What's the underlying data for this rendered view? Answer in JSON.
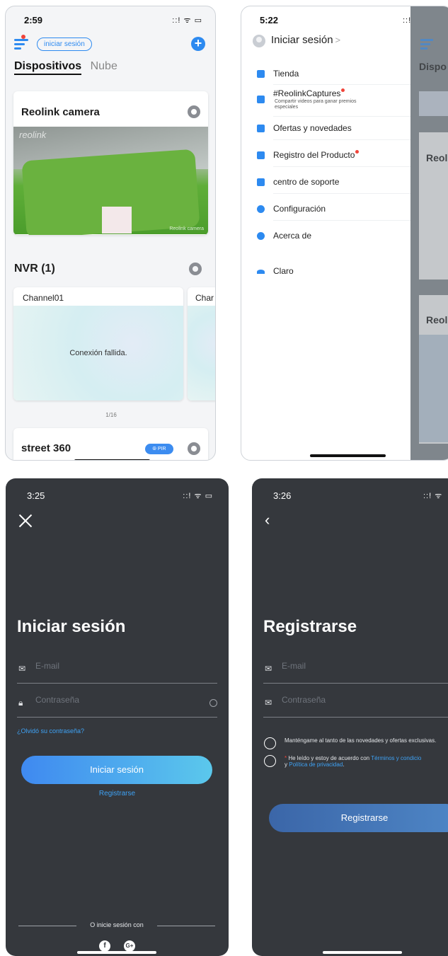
{
  "screen1": {
    "time": "2:59",
    "status_icons": "::! ᯤ ▭",
    "login_pill": "iniciar sesión",
    "add_symbol": "+",
    "tabs": [
      "Dispositivos",
      "Nube"
    ],
    "camera_card": {
      "title": "Reolink camera",
      "logo": "reolink",
      "watermark": "Reolink camera"
    },
    "nvr": {
      "title": "NVR (1)",
      "channels": [
        {
          "name": "Channel01",
          "message": "Conexión fallida."
        },
        {
          "name": "Char"
        }
      ],
      "pager": "1/16"
    },
    "street": {
      "title": "street 360",
      "badge": "⦾ PIR"
    }
  },
  "screen2": {
    "time": "5:22",
    "status_icons": "::! ᯤ ▭",
    "user": {
      "label": "Iniciar sesión",
      "chevron": ">"
    },
    "menu": [
      {
        "label": "Tienda"
      },
      {
        "label": "#ReolinkCaptures",
        "sub": "Compartir videos para ganar premios especiales"
      },
      {
        "label": "Ofertas y novedades"
      },
      {
        "label": "Registro del Producto"
      },
      {
        "label": "centro de soporte"
      },
      {
        "label": "Configuración"
      },
      {
        "label": "Acerca de"
      },
      {
        "label": "Claro"
      }
    ],
    "background_texts": {
      "tab": "Dispo",
      "card1": "Reol",
      "card2": "Reol"
    }
  },
  "screen3": {
    "time": "3:25",
    "status_icons": "::! ᯤ ▭",
    "title": "Iniciar sesión",
    "email_placeholder": "E-mail",
    "password_placeholder": "Contraseña",
    "forgot": "¿Olvidó su contraseña?",
    "login_button": "Iniciar sesión",
    "register_link": "Registrarse",
    "social_label": "O inicie sesión con",
    "social": [
      "f",
      "G+"
    ]
  },
  "screen4": {
    "time": "3:26",
    "status_icons": "::! ᯤ",
    "title": "Registrarse",
    "email_placeholder": "E-mail",
    "password_placeholder": "Contraseña",
    "newsletter": "Manténgame al tanto de las novedades y ofertas exclusivas.",
    "terms_prefix": "He leído y estoy de acuerdo con",
    "terms_link": "Términos y condicio",
    "terms_and": "y",
    "privacy_link": "Política de privacidad",
    "register_button": "Registrarse"
  },
  "colors": {
    "accent": "#2d8af0",
    "dark_bg": "#35383d",
    "alert": "#f0443a"
  }
}
